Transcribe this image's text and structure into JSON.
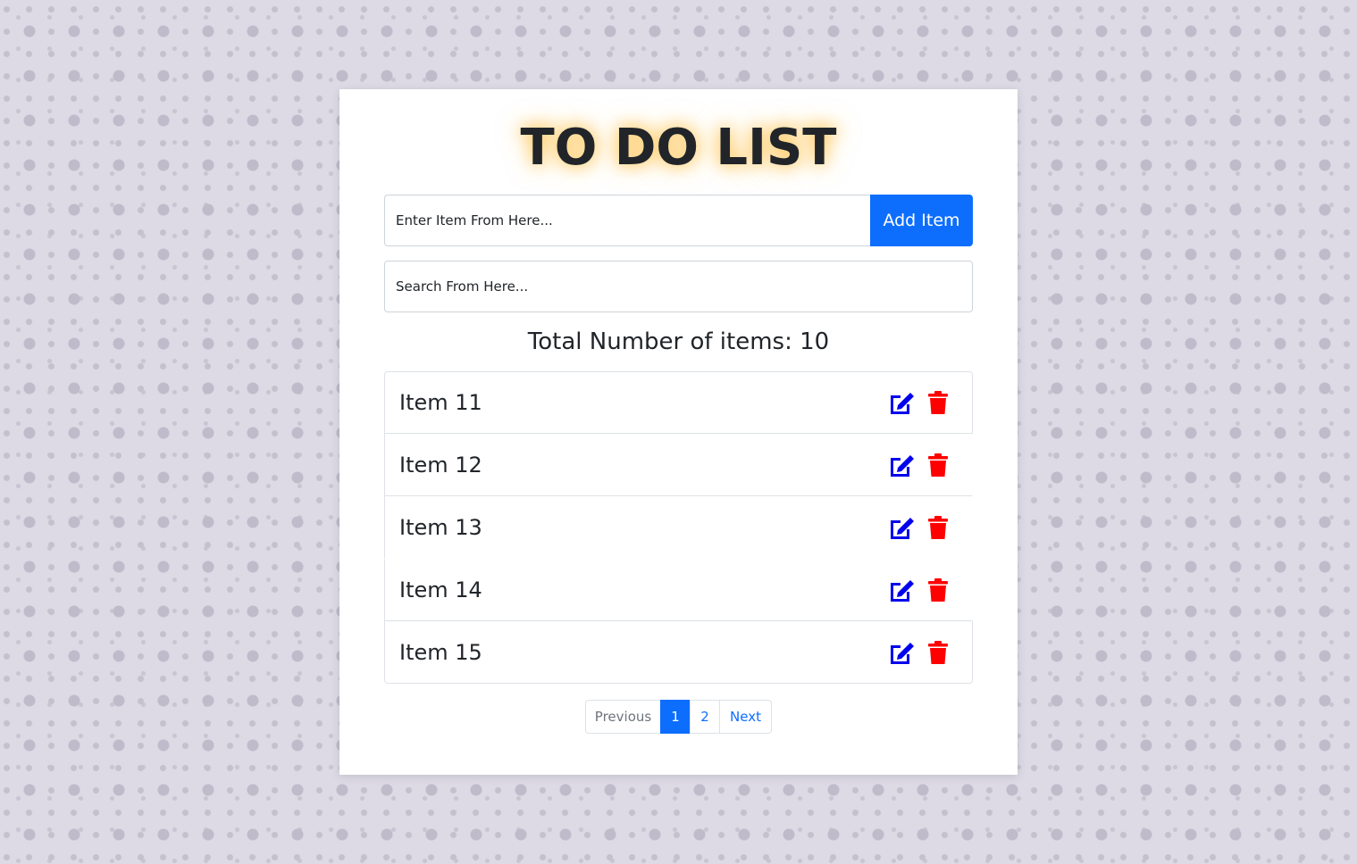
{
  "title": "TO DO LIST",
  "add_item": {
    "placeholder": "Enter Item From Here...",
    "button_label": "Add Item"
  },
  "search": {
    "placeholder": "Search From Here..."
  },
  "total": {
    "label": "Total Number of items: 10"
  },
  "items": [
    {
      "label": "Item 11"
    },
    {
      "label": "Item 12"
    },
    {
      "label": "Item 13"
    },
    {
      "label": "Item 14"
    },
    {
      "label": "Item 15"
    }
  ],
  "pagination": {
    "previous": "Previous",
    "pages": [
      "1",
      "2"
    ],
    "active_page": "1",
    "next": "Next"
  },
  "colors": {
    "accent": "#0d6efd",
    "edit_icon": "#0000ee",
    "delete_icon": "#ff0000",
    "title_glow": "#ffc451"
  },
  "icons": {
    "edit": "edit-icon",
    "delete": "trash-icon"
  }
}
